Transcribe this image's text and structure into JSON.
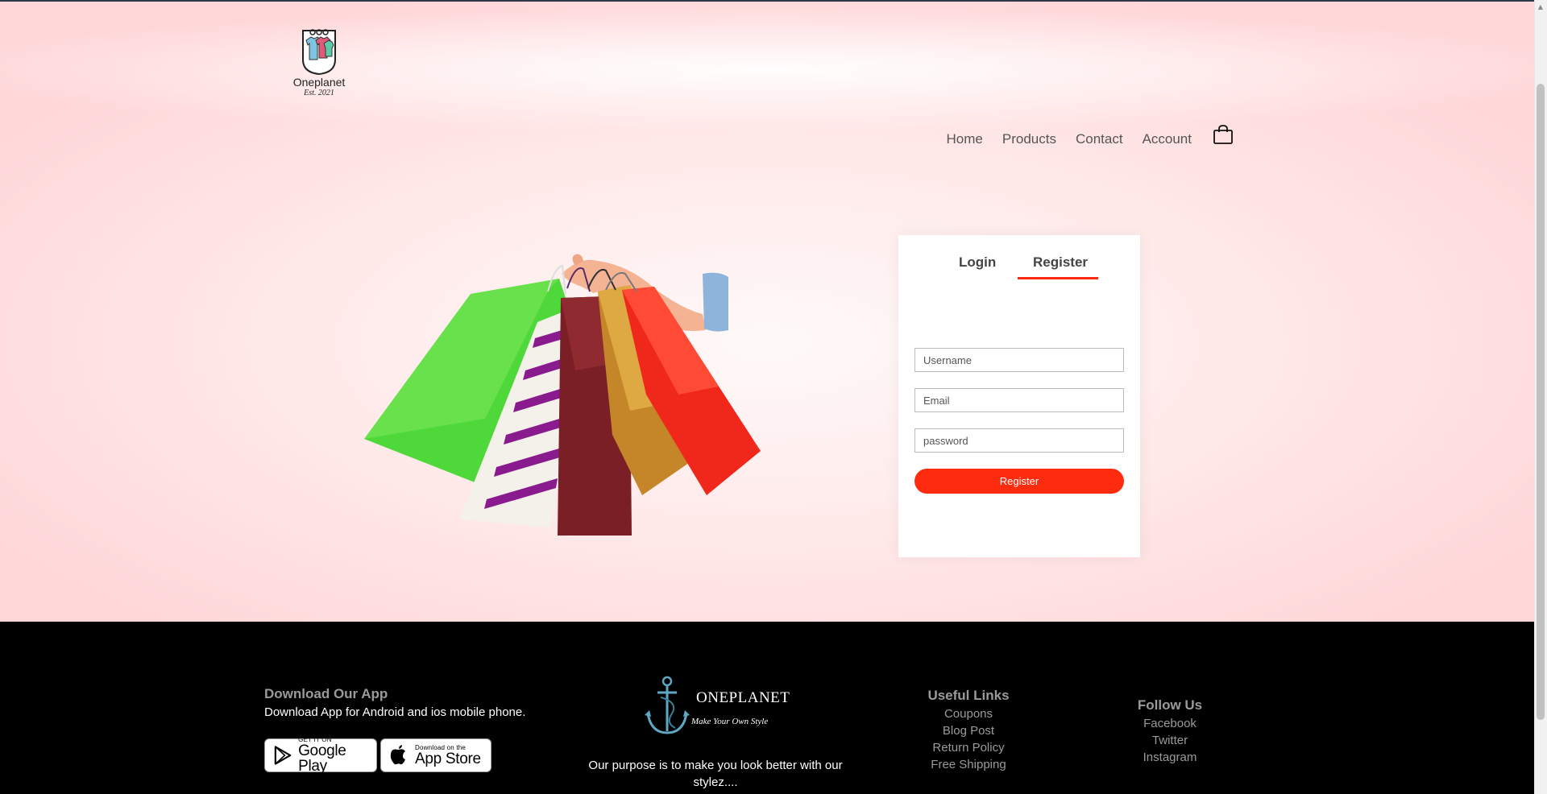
{
  "brand": {
    "logo_name": "Oneplanet",
    "logo_est": "Est. 2021"
  },
  "nav": {
    "items": [
      "Home",
      "Products",
      "Contact",
      "Account"
    ],
    "cart_icon": "shopping-bag-icon"
  },
  "form": {
    "tabs": {
      "login": "Login",
      "register": "Register",
      "active": "register"
    },
    "username_placeholder": "Username",
    "email_placeholder": "Email",
    "password_placeholder": "password",
    "submit_label": "Register",
    "accent_color": "#ff2b0e"
  },
  "footer": {
    "download": {
      "title": "Download Our App",
      "subtitle": "Download App for Android and ios mobile phone.",
      "google": {
        "small": "GET IT ON",
        "big": "Google Play"
      },
      "apple": {
        "small": "Download on the",
        "big": "App Store"
      }
    },
    "center": {
      "brand_name": "ONEPLANET",
      "tagline": "Make Your Own Style",
      "purpose": "Our purpose is to make you look better with our stylez...."
    },
    "useful_links": {
      "title": "Useful Links",
      "items": [
        "Coupons",
        "Blog Post",
        "Return Policy",
        "Free Shipping"
      ]
    },
    "follow_us": {
      "title": "Follow Us",
      "items": [
        "Facebook",
        "Twitter",
        "Instagram"
      ]
    }
  }
}
